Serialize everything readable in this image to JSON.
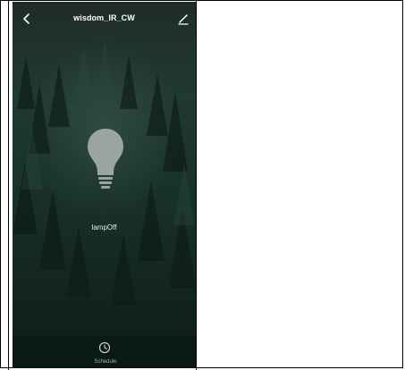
{
  "header": {
    "title": "wisdom_IR_CW"
  },
  "device": {
    "status": "lampOff",
    "power_on": false
  },
  "footer": {
    "schedule_label": "Schedule"
  },
  "icons": {
    "back": "chevron-left-icon",
    "edit": "edit-pencil-icon",
    "lamp": "lightbulb-icon",
    "schedule": "clock-icon"
  },
  "colors": {
    "background_dark": "#12241e",
    "bulb_off": "#9aa4a1",
    "title_text": "#ffffff"
  }
}
